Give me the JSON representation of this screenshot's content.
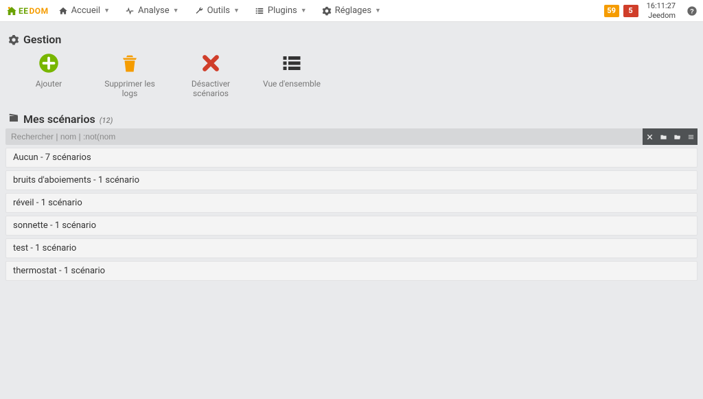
{
  "nav": {
    "items": [
      {
        "label": "Accueil",
        "icon": "home"
      },
      {
        "label": "Analyse",
        "icon": "heartbeat"
      },
      {
        "label": "Outils",
        "icon": "wrench"
      },
      {
        "label": "Plugins",
        "icon": "list"
      },
      {
        "label": "Réglages",
        "icon": "gear"
      }
    ],
    "badges": {
      "orange": "59",
      "red": "5"
    },
    "clock": "16:11:27",
    "user": "Jeedom"
  },
  "gestion": {
    "title": "Gestion",
    "actions": [
      {
        "label": "Ajouter",
        "icon": "plus-circle",
        "color": "#78b600"
      },
      {
        "label": "Supprimer les logs",
        "icon": "trash",
        "color": "#f59c00"
      },
      {
        "label": "Désactiver scénarios",
        "icon": "times",
        "color": "#d03e2a"
      },
      {
        "label": "Vue d'ensemble",
        "icon": "list-ul",
        "color": "#333333"
      }
    ]
  },
  "scenarios": {
    "title": "Mes scénarios",
    "count": "(12)",
    "search_placeholder": "Rechercher | nom | :not(nom",
    "groups": [
      {
        "label": "Aucun - 7 scénarios"
      },
      {
        "label": "bruits d'aboiements - 1 scénario"
      },
      {
        "label": "réveil - 1 scénario"
      },
      {
        "label": "sonnette - 1 scénario"
      },
      {
        "label": "test - 1 scénario"
      },
      {
        "label": "thermostat - 1 scénario"
      }
    ]
  }
}
